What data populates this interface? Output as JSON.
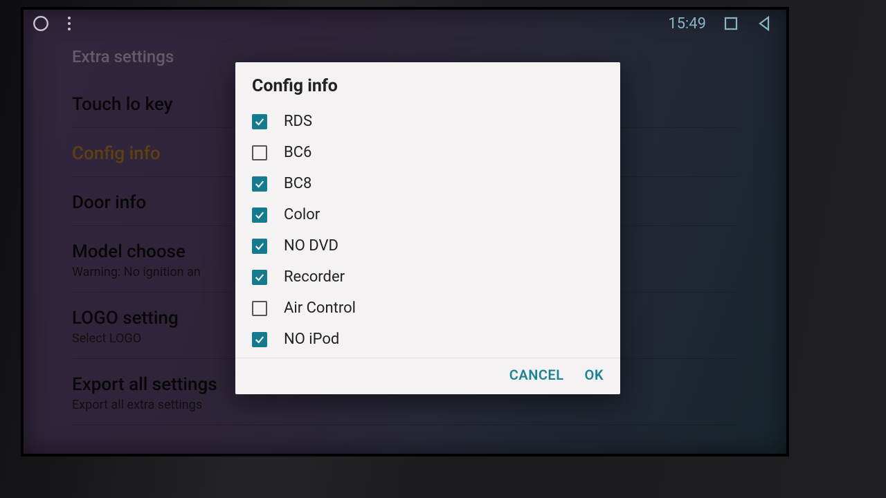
{
  "statusbar": {
    "time": "15:49"
  },
  "background": {
    "screen_title": "Extra settings",
    "items": [
      {
        "primary": "Touch lo key",
        "secondary": "",
        "selected": false
      },
      {
        "primary": "Config info",
        "secondary": "",
        "selected": true
      },
      {
        "primary": "Door info",
        "secondary": "",
        "selected": false
      },
      {
        "primary": "Model choose",
        "secondary": "Warning: No ignition an",
        "selected": false
      },
      {
        "primary": "LOGO setting",
        "secondary": "Select LOGO",
        "selected": false
      },
      {
        "primary": "Export all settings",
        "secondary": "Export all extra settings",
        "selected": false
      }
    ]
  },
  "dialog": {
    "title": "Config info",
    "options": [
      {
        "label": "RDS",
        "checked": true
      },
      {
        "label": "BC6",
        "checked": false
      },
      {
        "label": "BC8",
        "checked": true
      },
      {
        "label": "Color",
        "checked": true
      },
      {
        "label": "NO DVD",
        "checked": true
      },
      {
        "label": "Recorder",
        "checked": true
      },
      {
        "label": "Air Control",
        "checked": false
      },
      {
        "label": "NO iPod",
        "checked": true
      }
    ],
    "cancel_label": "CANCEL",
    "ok_label": "OK"
  }
}
